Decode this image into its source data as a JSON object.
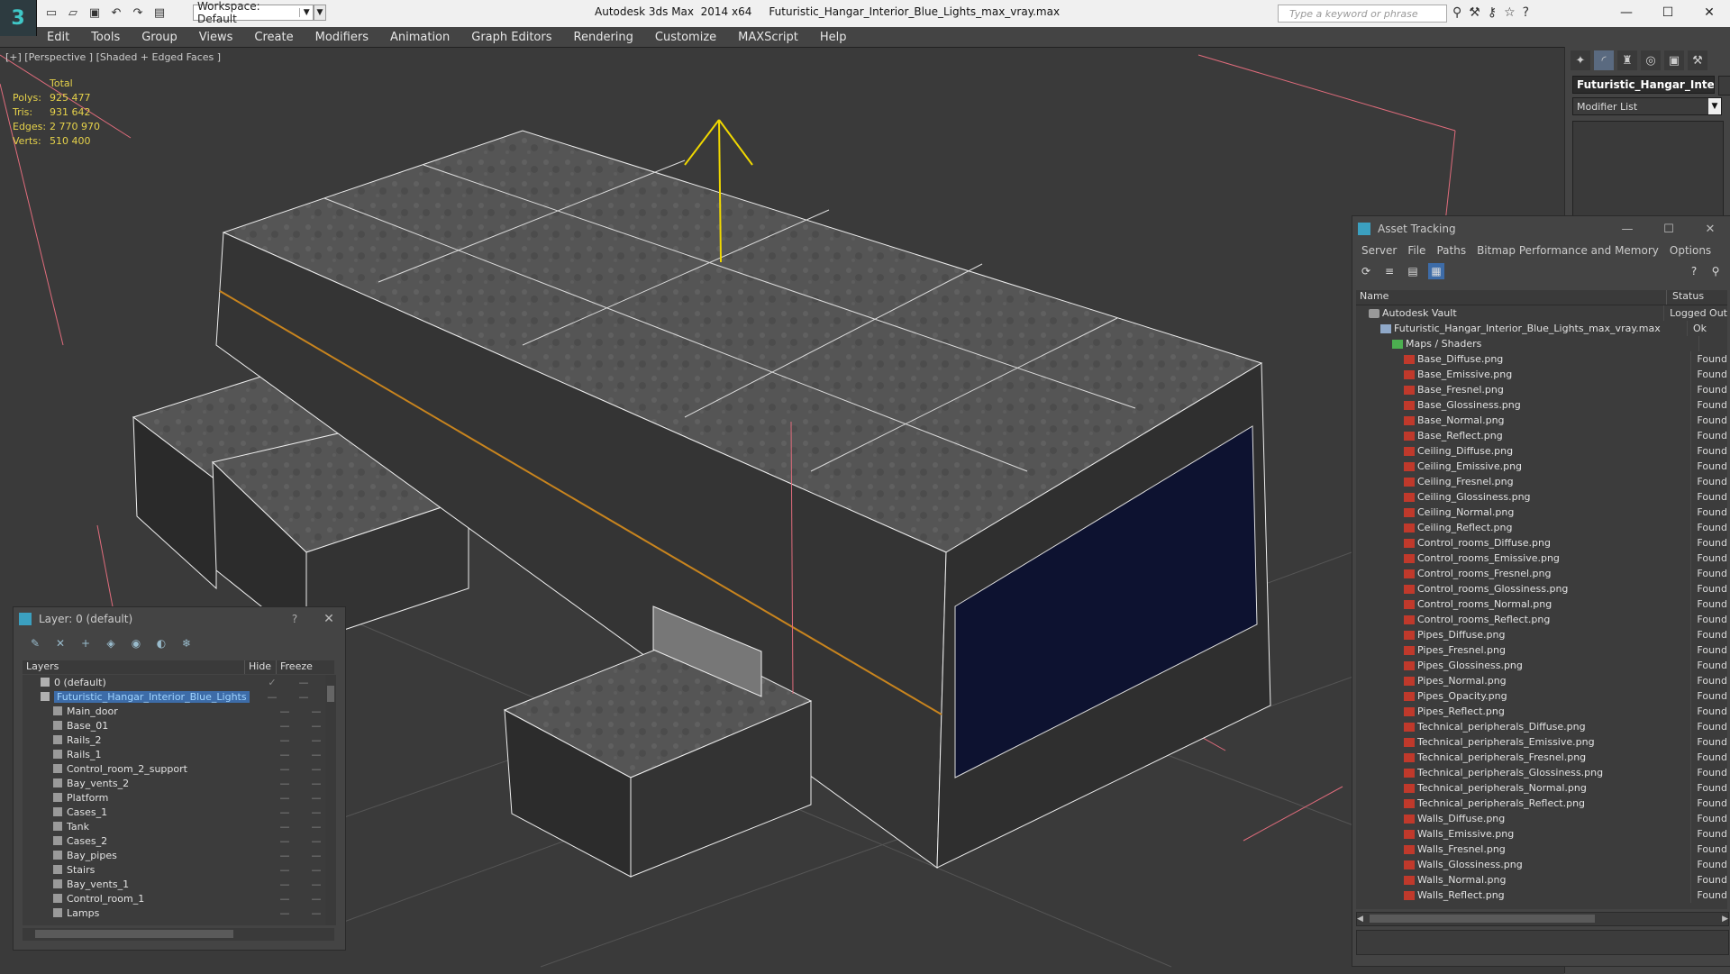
{
  "app": {
    "title": "Autodesk 3ds Max  2014 x64     Futuristic_Hangar_Interior_Blue_Lights_max_vray.max",
    "workspace": "Workspace: Default",
    "search_placeholder": "Type a keyword or phrase"
  },
  "menu": [
    "Edit",
    "Tools",
    "Group",
    "Views",
    "Create",
    "Modifiers",
    "Animation",
    "Graph Editors",
    "Rendering",
    "Customize",
    "MAXScript",
    "Help"
  ],
  "viewport": {
    "label": "[+] [Perspective ] [Shaded + Edged Faces ]",
    "stats": {
      "total_label": "Total",
      "rows": [
        {
          "label": "Polys:",
          "value": "925 477"
        },
        {
          "label": "Tris:",
          "value": "931 642"
        },
        {
          "label": "Edges:",
          "value": "2 770 970"
        },
        {
          "label": "Verts:",
          "value": "510 400"
        }
      ]
    }
  },
  "command_panel": {
    "object_name": "Futuristic_Hangar_Interi",
    "modifier_list": "Modifier List"
  },
  "asset_tracking": {
    "title": "Asset Tracking",
    "menu": [
      "Server",
      "File",
      "Paths",
      "Bitmap Performance and Memory",
      "Options"
    ],
    "col_name": "Name",
    "col_status": "Status",
    "rows": [
      {
        "name": "Autodesk Vault",
        "status": "Logged Out",
        "indent": 0,
        "icon": "vault"
      },
      {
        "name": "Futuristic_Hangar_Interior_Blue_Lights_max_vray.max",
        "status": "Ok",
        "indent": 1,
        "icon": "file"
      },
      {
        "name": "Maps / Shaders",
        "status": "",
        "indent": 2,
        "icon": "folder"
      },
      {
        "name": "Base_Diffuse.png",
        "status": "Found",
        "indent": 3,
        "icon": "png"
      },
      {
        "name": "Base_Emissive.png",
        "status": "Found",
        "indent": 3,
        "icon": "png"
      },
      {
        "name": "Base_Fresnel.png",
        "status": "Found",
        "indent": 3,
        "icon": "png"
      },
      {
        "name": "Base_Glossiness.png",
        "status": "Found",
        "indent": 3,
        "icon": "png"
      },
      {
        "name": "Base_Normal.png",
        "status": "Found",
        "indent": 3,
        "icon": "png"
      },
      {
        "name": "Base_Reflect.png",
        "status": "Found",
        "indent": 3,
        "icon": "png"
      },
      {
        "name": "Ceiling_Diffuse.png",
        "status": "Found",
        "indent": 3,
        "icon": "png"
      },
      {
        "name": "Ceiling_Emissive.png",
        "status": "Found",
        "indent": 3,
        "icon": "png"
      },
      {
        "name": "Ceiling_Fresnel.png",
        "status": "Found",
        "indent": 3,
        "icon": "png"
      },
      {
        "name": "Ceiling_Glossiness.png",
        "status": "Found",
        "indent": 3,
        "icon": "png"
      },
      {
        "name": "Ceiling_Normal.png",
        "status": "Found",
        "indent": 3,
        "icon": "png"
      },
      {
        "name": "Ceiling_Reflect.png",
        "status": "Found",
        "indent": 3,
        "icon": "png"
      },
      {
        "name": "Control_rooms_Diffuse.png",
        "status": "Found",
        "indent": 3,
        "icon": "png"
      },
      {
        "name": "Control_rooms_Emissive.png",
        "status": "Found",
        "indent": 3,
        "icon": "png"
      },
      {
        "name": "Control_rooms_Fresnel.png",
        "status": "Found",
        "indent": 3,
        "icon": "png"
      },
      {
        "name": "Control_rooms_Glossiness.png",
        "status": "Found",
        "indent": 3,
        "icon": "png"
      },
      {
        "name": "Control_rooms_Normal.png",
        "status": "Found",
        "indent": 3,
        "icon": "png"
      },
      {
        "name": "Control_rooms_Reflect.png",
        "status": "Found",
        "indent": 3,
        "icon": "png"
      },
      {
        "name": "Pipes_Diffuse.png",
        "status": "Found",
        "indent": 3,
        "icon": "png"
      },
      {
        "name": "Pipes_Fresnel.png",
        "status": "Found",
        "indent": 3,
        "icon": "png"
      },
      {
        "name": "Pipes_Glossiness.png",
        "status": "Found",
        "indent": 3,
        "icon": "png"
      },
      {
        "name": "Pipes_Normal.png",
        "status": "Found",
        "indent": 3,
        "icon": "png"
      },
      {
        "name": "Pipes_Opacity.png",
        "status": "Found",
        "indent": 3,
        "icon": "png"
      },
      {
        "name": "Pipes_Reflect.png",
        "status": "Found",
        "indent": 3,
        "icon": "png"
      },
      {
        "name": "Technical_peripherals_Diffuse.png",
        "status": "Found",
        "indent": 3,
        "icon": "png"
      },
      {
        "name": "Technical_peripherals_Emissive.png",
        "status": "Found",
        "indent": 3,
        "icon": "png"
      },
      {
        "name": "Technical_peripherals_Fresnel.png",
        "status": "Found",
        "indent": 3,
        "icon": "png"
      },
      {
        "name": "Technical_peripherals_Glossiness.png",
        "status": "Found",
        "indent": 3,
        "icon": "png"
      },
      {
        "name": "Technical_peripherals_Normal.png",
        "status": "Found",
        "indent": 3,
        "icon": "png"
      },
      {
        "name": "Technical_peripherals_Reflect.png",
        "status": "Found",
        "indent": 3,
        "icon": "png"
      },
      {
        "name": "Walls_Diffuse.png",
        "status": "Found",
        "indent": 3,
        "icon": "png"
      },
      {
        "name": "Walls_Emissive.png",
        "status": "Found",
        "indent": 3,
        "icon": "png"
      },
      {
        "name": "Walls_Fresnel.png",
        "status": "Found",
        "indent": 3,
        "icon": "png"
      },
      {
        "name": "Walls_Glossiness.png",
        "status": "Found",
        "indent": 3,
        "icon": "png"
      },
      {
        "name": "Walls_Normal.png",
        "status": "Found",
        "indent": 3,
        "icon": "png"
      },
      {
        "name": "Walls_Reflect.png",
        "status": "Found",
        "indent": 3,
        "icon": "png"
      }
    ]
  },
  "layers": {
    "title": "Layer: 0 (default)",
    "help": "?",
    "col_layers": "Layers",
    "col_hide": "Hide",
    "col_freeze": "Freeze",
    "rows": [
      {
        "name": "0 (default)",
        "indent": 1,
        "type": "layer",
        "selected": false,
        "check": true
      },
      {
        "name": "Futuristic_Hangar_Interior_Blue_Lights",
        "indent": 1,
        "type": "layer",
        "selected": true,
        "check": false
      },
      {
        "name": "Main_door",
        "indent": 2,
        "type": "object",
        "selected": false,
        "check": false
      },
      {
        "name": "Base_01",
        "indent": 2,
        "type": "object",
        "selected": false,
        "check": false
      },
      {
        "name": "Rails_2",
        "indent": 2,
        "type": "object",
        "selected": false,
        "check": false
      },
      {
        "name": "Rails_1",
        "indent": 2,
        "type": "object",
        "selected": false,
        "check": false
      },
      {
        "name": "Control_room_2_support",
        "indent": 2,
        "type": "object",
        "selected": false,
        "check": false
      },
      {
        "name": "Bay_vents_2",
        "indent": 2,
        "type": "object",
        "selected": false,
        "check": false
      },
      {
        "name": "Platform",
        "indent": 2,
        "type": "object",
        "selected": false,
        "check": false
      },
      {
        "name": "Cases_1",
        "indent": 2,
        "type": "object",
        "selected": false,
        "check": false
      },
      {
        "name": "Tank",
        "indent": 2,
        "type": "object",
        "selected": false,
        "check": false
      },
      {
        "name": "Cases_2",
        "indent": 2,
        "type": "object",
        "selected": false,
        "check": false
      },
      {
        "name": "Bay_pipes",
        "indent": 2,
        "type": "object",
        "selected": false,
        "check": false
      },
      {
        "name": "Stairs",
        "indent": 2,
        "type": "object",
        "selected": false,
        "check": false
      },
      {
        "name": "Bay_vents_1",
        "indent": 2,
        "type": "object",
        "selected": false,
        "check": false
      },
      {
        "name": "Control_room_1",
        "indent": 2,
        "type": "object",
        "selected": false,
        "check": false
      },
      {
        "name": "Lamps",
        "indent": 2,
        "type": "object",
        "selected": false,
        "check": false
      }
    ]
  }
}
